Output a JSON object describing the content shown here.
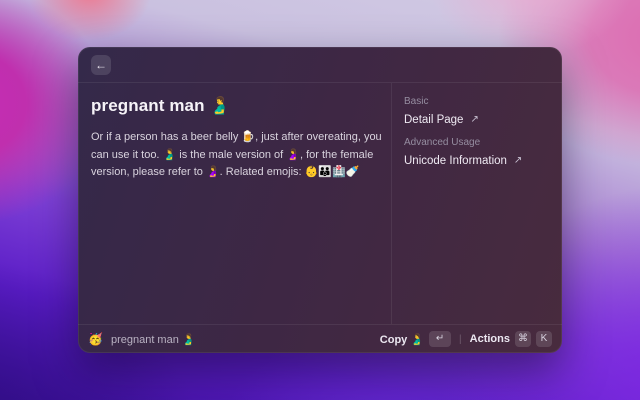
{
  "window": {
    "header": {
      "back_icon": "←"
    },
    "main": {
      "title": "pregnant man 🫃",
      "description": "Or if a person has a beer belly 🍺, just after overeating, you can use it too. 🫃 is the male version of 🤰, for the female version, please refer to 🤰. Related emojis: 👶👪🏥🍼"
    },
    "sidebar": {
      "sections": [
        {
          "label": "Basic",
          "links": [
            {
              "text": "Detail Page",
              "icon": "↗"
            }
          ]
        },
        {
          "label": "Advanced Usage",
          "links": [
            {
              "text": "Unicode Information",
              "icon": "↗"
            }
          ]
        }
      ]
    },
    "footer": {
      "app_icon": "🥳",
      "selected_item": "pregnant man 🫃",
      "primary_action": {
        "label": "Copy 🫃",
        "key": "↵"
      },
      "secondary_action": {
        "label": "Actions",
        "keys": [
          "⌘",
          "K"
        ]
      }
    }
  },
  "colors": {
    "window_background_left": "#34294a",
    "window_background_right": "#482b3e",
    "wallpaper_magenta": "#c52cb6",
    "wallpaper_violet": "#7d22e4"
  }
}
